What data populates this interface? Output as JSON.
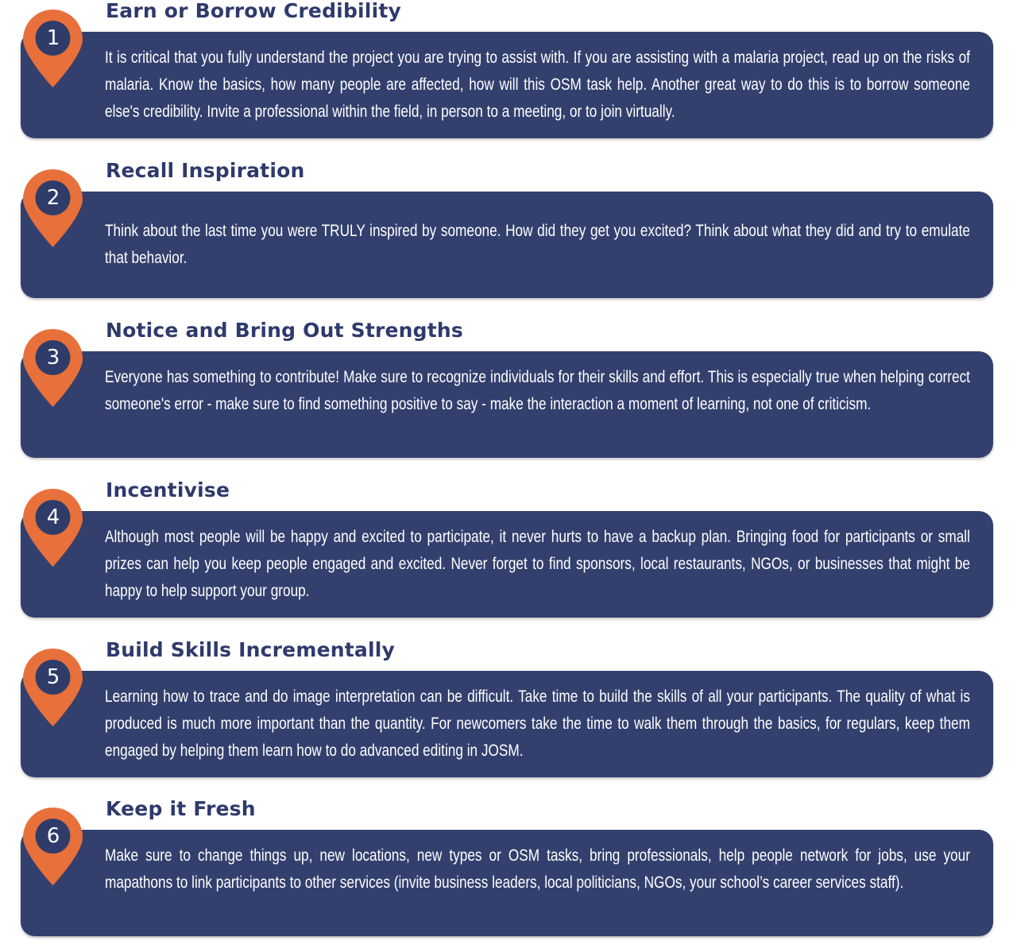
{
  "items": [
    {
      "number": "1",
      "title": "Earn or Borrow Credibility",
      "text": "It is critical that you fully understand the project you are trying to assist with.  If you are assisting with a malaria project, read up on the risks of malaria. Know the basics, how many people are affected, how will this OSM task help. Another great way to do this is to borrow someone else's credibility.  Invite a professional within the field, in person to a meeting, or to join virtually."
    },
    {
      "number": "2",
      "title": "Recall Inspiration",
      "text": "Think about the last time you were TRULY inspired by someone. How did they get you excited? Think about what they did and try to emulate that behavior."
    },
    {
      "number": "3",
      "title": "Notice and Bring Out Strengths",
      "text": "Everyone has something to contribute! Make sure to recognize individuals for their skills and effort. This is especially true when helping correct someone's error - make sure to find something positive to say - make the interaction a moment of learning, not one of criticism."
    },
    {
      "number": "4",
      "title": "Incentivise",
      "text": "Although most people will be happy and excited to participate, it never hurts to have a backup plan.  Bringing food for participants or small prizes can help you keep people engaged and excited. Never forget to find sponsors, local restaurants, NGOs, or businesses that might be happy to help support your group."
    },
    {
      "number": "5",
      "title": "Build Skills Incrementally",
      "text": "Learning how to trace and do image interpretation can be difficult. Take time to build the skills of all your participants. The quality of what is produced is much more important than the quantity. For newcomers take the time to walk them through the basics, for regulars, keep them engaged by helping them learn how to do advanced editing in JOSM."
    },
    {
      "number": "6",
      "title": "Keep it Fresh",
      "text": "Make sure to change things up, new locations, new types or OSM tasks, bring professionals, help people network for jobs, use your mapathons to link participants to other services (invite business leaders, local politicians, NGOs, your school’s career services staff)."
    }
  ],
  "colors": {
    "panel": "#33406e",
    "title": "#2e3a6c",
    "pin": "#e8703a",
    "pin_inner": "#2f3c6a",
    "text": "#ffffff"
  },
  "icons": {
    "marker": "map-marker-icon"
  }
}
